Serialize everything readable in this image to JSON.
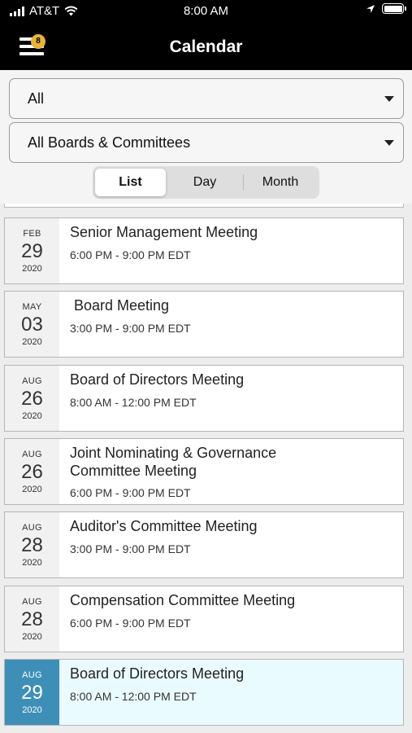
{
  "status_bar": {
    "carrier": "AT&T",
    "time": "8:00 AM"
  },
  "header": {
    "title": "Calendar",
    "menu_badge": "8"
  },
  "filters": {
    "type_select": "All",
    "group_select": "All Boards & Committees",
    "view_tabs": [
      "List",
      "Day",
      "Month"
    ],
    "active_tab": "List"
  },
  "colors": {
    "header_bg": "#000000",
    "badge": "#e6b43c",
    "selected_date_bg": "#3d8fb8",
    "selected_row_bg": "#eafbff"
  },
  "events": [
    {
      "month": "FEB",
      "day": "29",
      "year": "2020",
      "title": "Senior Management Meeting",
      "time": "6:00 PM - 9:00 PM EDT"
    },
    {
      "month": "MAY",
      "day": "03",
      "year": "2020",
      "title": " Board Meeting",
      "time": "3:00 PM - 9:00 PM EDT"
    },
    {
      "month": "AUG",
      "day": "26",
      "year": "2020",
      "title": "Board of Directors Meeting",
      "time": "8:00 AM - 12:00 PM EDT"
    },
    {
      "month": "AUG",
      "day": "26",
      "year": "2020",
      "title": "Joint Nominating & Governance Committee Meeting",
      "time": "6:00 PM - 9:00 PM EDT"
    },
    {
      "month": "AUG",
      "day": "28",
      "year": "2020",
      "title": "Auditor's Committee Meeting",
      "time": "3:00 PM - 9:00 PM EDT"
    },
    {
      "month": "AUG",
      "day": "28",
      "year": "2020",
      "title": "Compensation Committee Meeting",
      "time": "6:00 PM - 9:00 PM EDT"
    },
    {
      "month": "AUG",
      "day": "29",
      "year": "2020",
      "title": "Board of Directors Meeting",
      "time": "8:00 AM - 12:00 PM EDT",
      "selected": true
    }
  ]
}
